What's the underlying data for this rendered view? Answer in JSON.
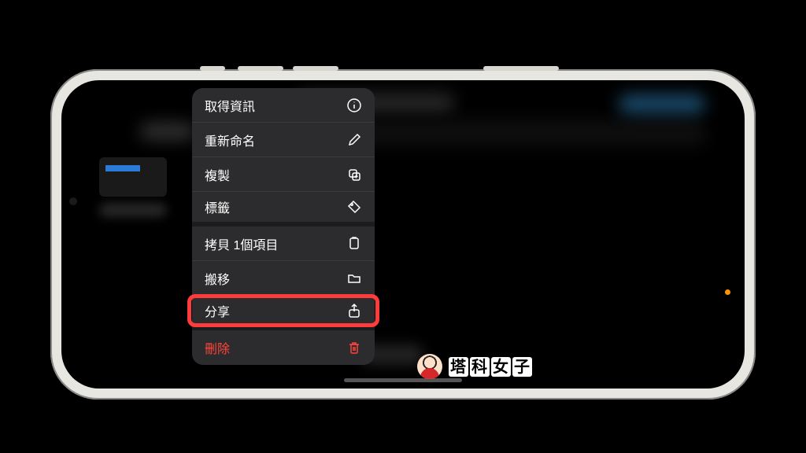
{
  "menu": {
    "group1": [
      {
        "label": "取得資訊",
        "icon": "info-icon"
      },
      {
        "label": "重新命名",
        "icon": "pencil-icon"
      },
      {
        "label": "複製",
        "icon": "duplicate-icon"
      },
      {
        "label": "標籤",
        "icon": "tag-icon"
      }
    ],
    "group2": [
      {
        "label": "拷貝 1個項目",
        "icon": "copy-icon"
      },
      {
        "label": "搬移",
        "icon": "folder-icon"
      },
      {
        "label": "分享",
        "icon": "share-icon",
        "highlighted": true
      }
    ],
    "group3": [
      {
        "label": "刪除",
        "icon": "trash-icon",
        "destructive": true
      }
    ]
  },
  "watermark": {
    "text": "塔科女子"
  },
  "colors": {
    "destructive": "#ff453a",
    "highlight": "#ff3b3b",
    "menu_bg": "#2c2c2e"
  }
}
